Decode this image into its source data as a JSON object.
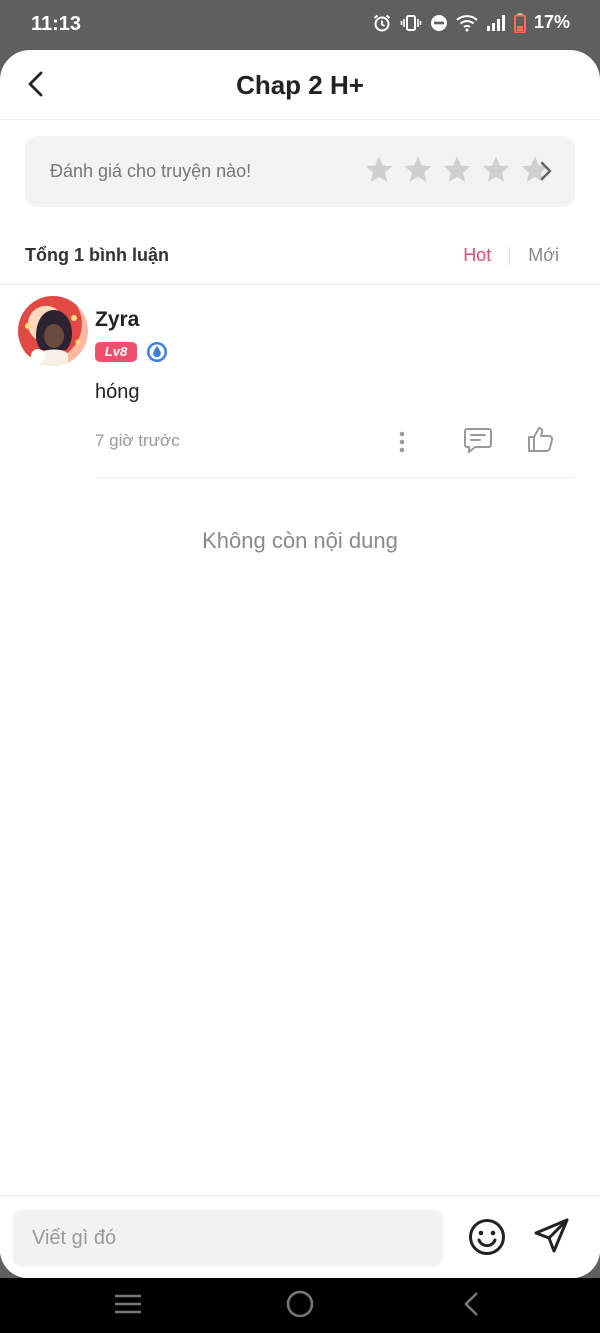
{
  "status_bar": {
    "time": "11:13",
    "battery": "17%",
    "icons": [
      "alarm-icon",
      "vibrate-icon",
      "do-not-disturb-icon",
      "wifi-icon",
      "signal-icon",
      "battery-icon"
    ]
  },
  "header": {
    "title": "Chap 2 H+",
    "back_icon": "chevron-left-icon"
  },
  "rating": {
    "prompt": "Đánh giá cho truyện nào!",
    "stars_total": 5,
    "stars_selected": 0,
    "star_color": "#cfcfcf"
  },
  "comments_header": {
    "count_label": "Tổng 1 bình luận",
    "sort_hot": "Hot",
    "sort_new": "Mới",
    "active_sort": "Hot",
    "accent": "#e8496a"
  },
  "comments": [
    {
      "username": "Zyra",
      "level": "Lv8",
      "text": "hóng",
      "time": "7 giờ trước",
      "badge_icon": "water-drop-badge-icon"
    }
  ],
  "end_message": "Không còn nội dung",
  "composer": {
    "placeholder": "Viết gì đó",
    "emoji_icon": "smiley-icon",
    "send_icon": "send-icon"
  },
  "nav_bar": {
    "icons": [
      "menu-icon",
      "home-icon",
      "back-icon"
    ]
  }
}
